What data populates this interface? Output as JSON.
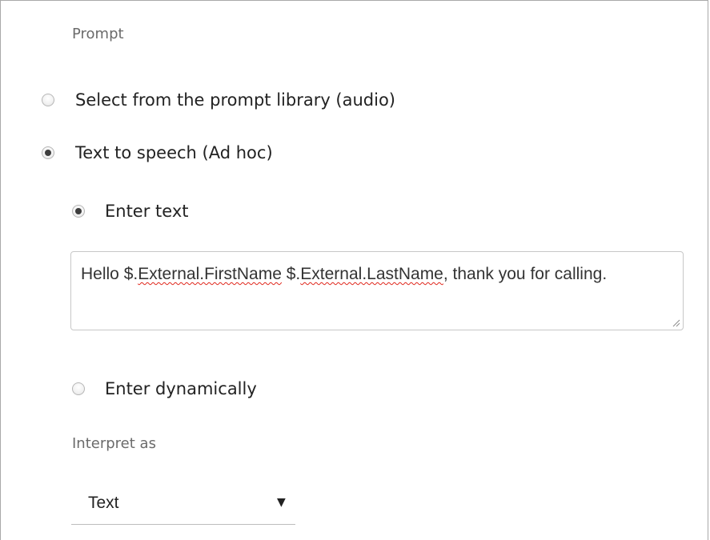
{
  "prompt_section": {
    "label": "Prompt",
    "options": [
      {
        "label": "Select from the prompt library (audio)",
        "selected": false
      },
      {
        "label": "Text to speech (Ad hoc)",
        "selected": true
      }
    ]
  },
  "tts_section": {
    "options": [
      {
        "label": "Enter text",
        "selected": true
      },
      {
        "label": "Enter dynamically",
        "selected": false
      }
    ],
    "text_value": {
      "part1": "Hello $.",
      "word1": "External.FirstName",
      "part2": " $.",
      "word2": "External.LastName",
      "part3": ", thank you for calling."
    }
  },
  "interpret_as": {
    "label": "Interpret as",
    "selected_value": "Text",
    "caret_icon": "triangle-down-icon"
  },
  "colors": {
    "border": "#a9a9a9",
    "label_gray": "#6b6b6b",
    "spellcheck": "#e0261b"
  }
}
